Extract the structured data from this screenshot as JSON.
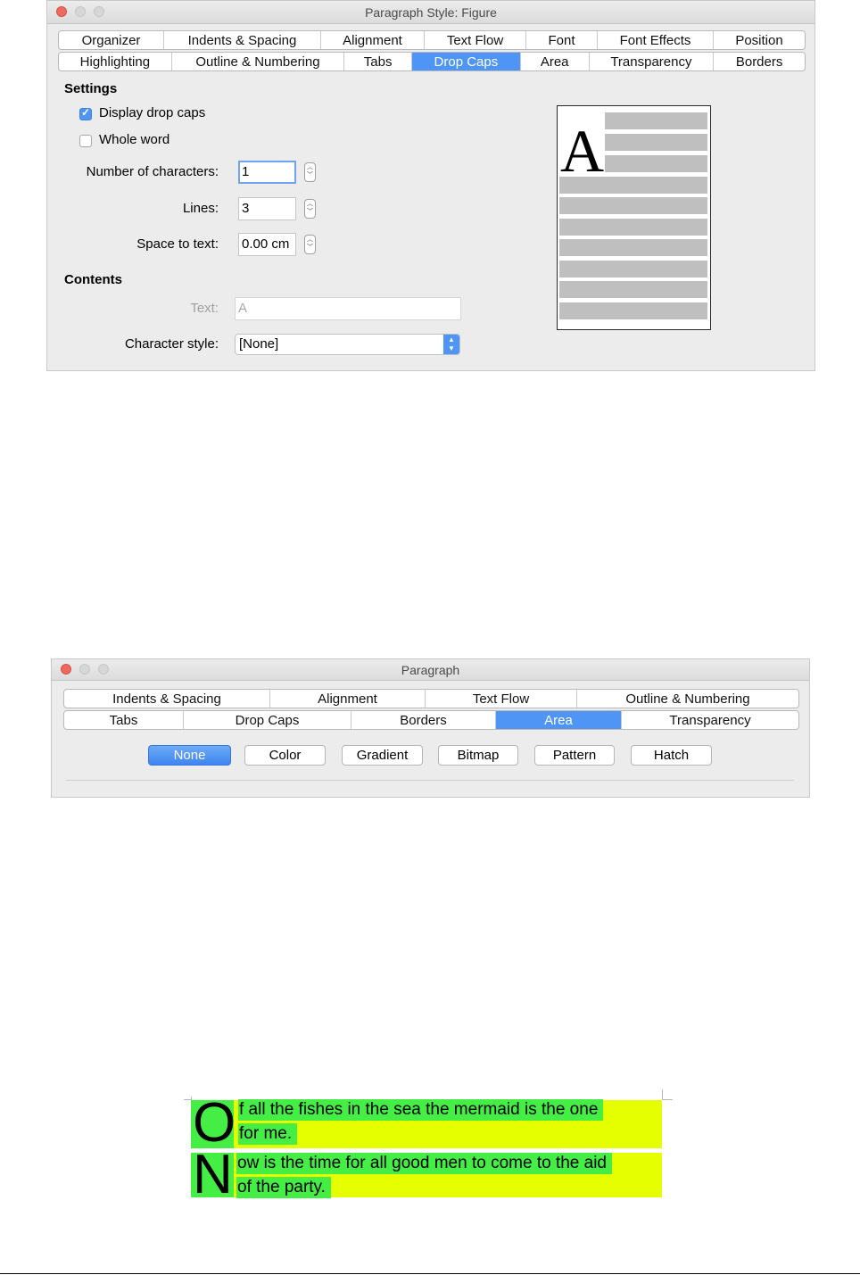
{
  "dialog1": {
    "title": "Paragraph Style: Figure",
    "tabs_row1": [
      "Organizer",
      "Indents & Spacing",
      "Alignment",
      "Text Flow",
      "Font",
      "Font Effects",
      "Position"
    ],
    "tabs_row2": [
      "Highlighting",
      "Outline & Numbering",
      "Tabs",
      "Drop Caps",
      "Area",
      "Transparency",
      "Borders"
    ],
    "active_tab": "Drop Caps",
    "settings": {
      "title": "Settings",
      "display_drop_caps": {
        "label": "Display drop caps",
        "checked": true
      },
      "whole_word": {
        "label": "Whole word",
        "checked": false
      },
      "number_of_characters": {
        "label": "Number of characters:",
        "value": "1"
      },
      "lines": {
        "label": "Lines:",
        "value": "3"
      },
      "space_to_text": {
        "label": "Space to text:",
        "value": "0.00 cm"
      }
    },
    "contents": {
      "title": "Contents",
      "text": {
        "label": "Text:",
        "value": "A"
      },
      "character_style": {
        "label": "Character style:",
        "value": "[None]"
      }
    },
    "preview_letter": "A"
  },
  "dialog2": {
    "title": "Paragraph",
    "tabs_row1": [
      "Indents & Spacing",
      "Alignment",
      "Text Flow",
      "Outline & Numbering"
    ],
    "tabs_row2": [
      "Tabs",
      "Drop Caps",
      "Borders",
      "Area",
      "Transparency"
    ],
    "active_tab": "Area",
    "area_buttons": [
      "None",
      "Color",
      "Gradient",
      "Bitmap",
      "Pattern",
      "Hatch"
    ],
    "active_button": "None"
  },
  "document": {
    "paragraphs": [
      {
        "dropcap": "O",
        "lines": [
          "f all the fishes in the sea the mermaid is the one",
          "for me."
        ]
      },
      {
        "dropcap": "N",
        "lines": [
          "ow is the time for all good men to come to the aid",
          "of the party."
        ]
      }
    ],
    "colors": {
      "paragraph_background": "#e5ff00",
      "text_highlight": "#44ee44"
    }
  }
}
